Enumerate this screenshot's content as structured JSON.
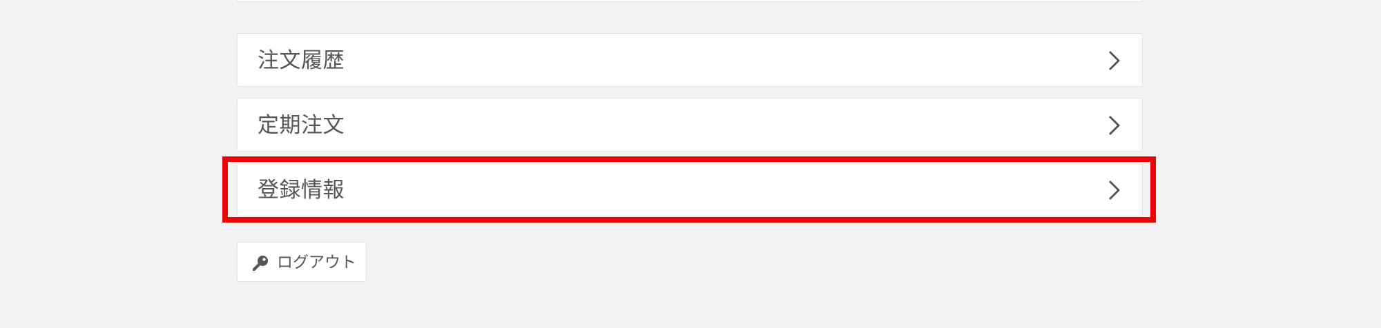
{
  "menu": {
    "items": [
      {
        "label": "注文履歴",
        "icon": "chevron-right-icon"
      },
      {
        "label": "定期注文",
        "icon": "chevron-right-icon"
      },
      {
        "label": "登録情報",
        "icon": "chevron-right-icon"
      }
    ]
  },
  "logout": {
    "label": "ログアウト",
    "icon": "key-icon"
  },
  "colors": {
    "background": "#f3f3f5",
    "text": "#555557",
    "highlight": "#ee0000"
  }
}
